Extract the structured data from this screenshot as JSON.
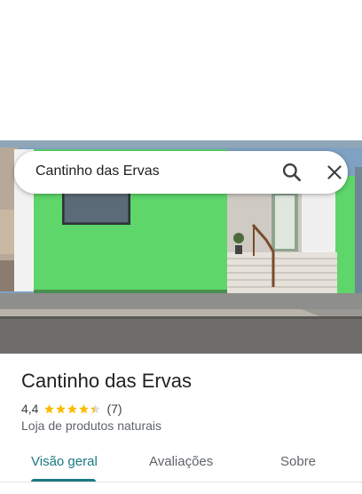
{
  "search": {
    "query": "Cantinho das Ervas"
  },
  "place": {
    "name": "Cantinho das Ervas",
    "rating": "4,4",
    "rating_stars": 4.4,
    "review_count": "(7)",
    "category": "Loja de produtos naturais"
  },
  "tabs": [
    {
      "label": "Visão geral",
      "active": true
    },
    {
      "label": "Avaliações",
      "active": false
    },
    {
      "label": "Sobre",
      "active": false
    }
  ],
  "colors": {
    "accent": "#1a7a80",
    "star": "#fbbc04",
    "wall": "#5ed66a"
  },
  "icons": {
    "search": "search-icon",
    "close": "close-icon",
    "star": "star-icon"
  }
}
